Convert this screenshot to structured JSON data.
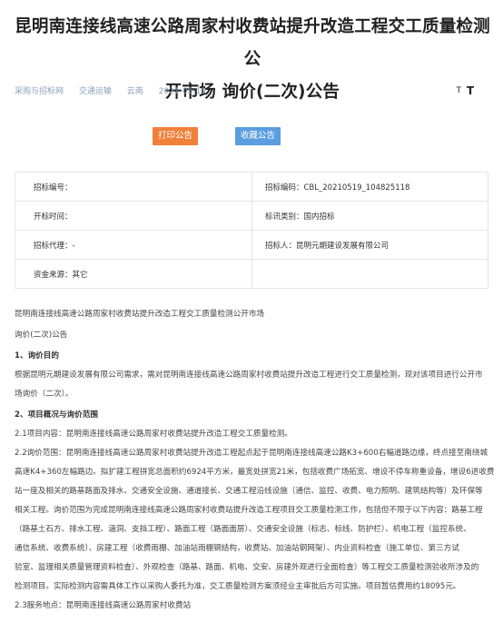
{
  "article": {
    "title_line1": "昆明南连接线高速公路周家村收费站提升改造工程交工质量检测公",
    "title_line2": "开市场 询价(二次)公告"
  },
  "meta": {
    "category": "采购与招标网",
    "industry": "交通运输",
    "region": "云南",
    "date": "2021-05-19",
    "font_small": "T",
    "font_large": "T"
  },
  "buttons": {
    "print": "打印公告",
    "favorite": "收藏公告"
  },
  "info_table": {
    "row1_left": "招标编号：",
    "row1_right": "招标编码：CBL_20210519_104825118",
    "row2_left": "开标时间：",
    "row2_right": "标讯类别：国内招标",
    "row3_left": "招标代理：-",
    "row3_right": "招标人：昆明元期建设发展有限公司",
    "row4_left": "资金来源：其它"
  },
  "content": {
    "p1": "昆明南连接线高速公路周家村收费站提升改造工程交工质量检测公开市场",
    "p2": "询价(二次)公告",
    "h1": "1、询价目的",
    "p3": "根据昆明元期建设发展有限公司需求，需对昆明南连接线高速公路周家村收费站提升改造工程进行交工质量检测，现对该项目进行公开市",
    "p4": "场询价（二次）。",
    "h2": "2、项目概况与询价范围",
    "p5": "2.1项目内容：昆明南连接线高速公路周家村收费站提升改造工程交工质量检测。",
    "p6": "2.2询价范围：昆明南连接线高速公路周家村收费站提升改造工程起点起于昆明南连接线高速公路K3+600右幅道路边缘，终点接至南绕城",
    "p7": "高速K4+360左幅路边。拟扩建工程拼宽总面积约6924平方米，最宽处拼宽21米，包括收费广场拓宽、增设不停车称重设备，增设6进收费",
    "p8": "站一座及相关的路基路面及排水、交通安全设施、通道接长、交通工程沿线设施（通信、监控、收费、电力照明、建筑结构等）及环保等",
    "p9": "相关工程。询价范围为完成昆明南连接线高速公路周家村收费站提升改造工程项目交工质量检测工作，包括但不限于以下内容：路基工程",
    "p10": "（路基土石方、排水工程、涵洞、支挡工程）、路面工程（路面面层）、交通安全设施（标志、标线、防护栏）、机电工程（监控系统、",
    "p11": "通信系统、收费系统）、房建工程（收费雨棚、加油站雨棚钢结构，收费站、加油站钢网架）、内业资料检查（施工单位、第三方试",
    "p12": "验室、监理相关质量管理资料检查）、外观检查（路基、路面、机电、交安、房建外观进行全面检查）等工程交工质量检测验收所涉及的",
    "p13": "检测项目。实际检测内容需具体工作以采购人委托为准，交工质量检测方案须经业主审批后方可实施。项目暂估费用约18095元。",
    "p14": "2.3服务地点：昆明南连接线高速公路周家村收费站"
  }
}
